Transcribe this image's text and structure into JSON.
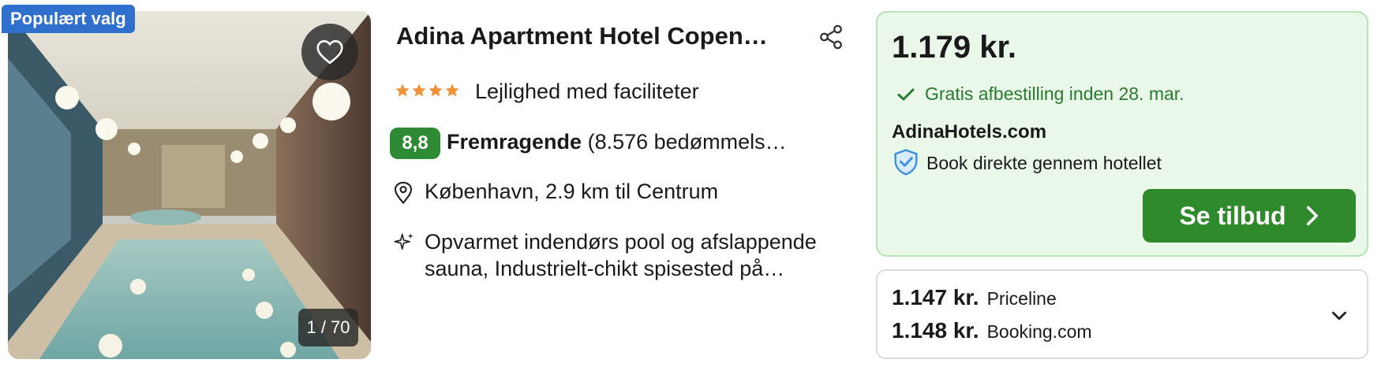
{
  "photo": {
    "badge": "Populært valg",
    "counter": "1 / 70"
  },
  "hotel": {
    "title": "Adina Apartment Hotel Copen…",
    "star_count": 4,
    "type": "Lejlighed med faciliteter",
    "rating_score": "8,8",
    "rating_label": "Fremragende",
    "rating_count": "(8.576 bedømmels…",
    "location": "København, 2.9 km til Centrum",
    "description_line1": "Opvarmet indendørs pool og afslappende",
    "description_line2": "sauna, Industrielt-chikt spisested på…"
  },
  "deal": {
    "price": "1.179 kr.",
    "cancellation": "Gratis afbestilling inden 28. mar.",
    "provider": "AdinaHotels.com",
    "direct": "Book direkte gennem hotellet",
    "cta": "Se tilbud"
  },
  "offers": [
    {
      "price": "1.147 kr.",
      "site": "Priceline"
    },
    {
      "price": "1.148 kr.",
      "site": "Booking.com"
    }
  ],
  "colors": {
    "accent_green": "#2f8a2c",
    "badge_blue": "#2f6fce",
    "star_orange": "#f0923a"
  },
  "icons": [
    "heart-icon",
    "share-icon",
    "star-icon",
    "map-pin-icon",
    "sparkle-icon",
    "check-icon",
    "shield-icon",
    "chevron-right-icon",
    "chevron-down-icon"
  ]
}
